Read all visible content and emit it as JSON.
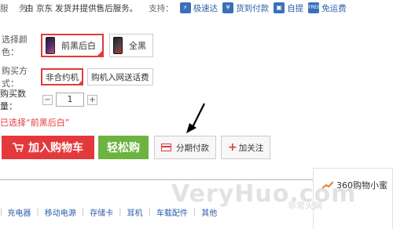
{
  "service": {
    "label": "服",
    "label2": "务：",
    "text": "由 京东 发货并提供售后服务。",
    "support_label": "支持：",
    "badges": [
      "极速达",
      "货到付款",
      "自提",
      "免运费"
    ]
  },
  "color": {
    "label": "选择颜色：",
    "options": [
      {
        "label": "前黑后白",
        "selected": true
      },
      {
        "label": "全黑",
        "selected": false
      }
    ]
  },
  "buy_type": {
    "label": "购买方式：",
    "options": [
      {
        "label": "非合约机",
        "selected": true
      },
      {
        "label": "购机入网送话费",
        "selected": false
      }
    ]
  },
  "quantity": {
    "label": "购买数量：",
    "minus": "−",
    "value": "1",
    "plus": "+"
  },
  "selected_text": "已选择“前黑后白”",
  "buttons": {
    "add_cart": "加入购物车",
    "easy_buy": "轻松购",
    "installment": "分期付款",
    "follow": "加关注"
  },
  "side_tab": {
    "label": "360购物小蜜"
  },
  "categories": [
    "充电器",
    "移动电源",
    "存储卡",
    "耳机",
    "车载配件",
    "其他"
  ],
  "watermark": {
    "main": "VeryHuo.com",
    "sub": "非常火网"
  },
  "colors": {
    "accent": "#e4393c",
    "green": "#6cb33f",
    "link": "#2b5da8"
  }
}
